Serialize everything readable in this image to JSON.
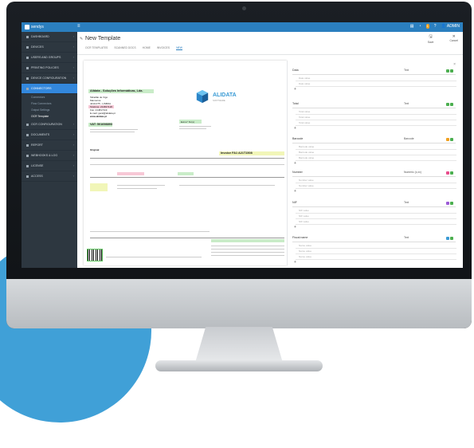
{
  "app": {
    "logo_text": "sendys",
    "title": "New Template",
    "breadcrumbs": [
      "OCR TEMPLATES",
      "SCANNED DOCS",
      "HOME",
      "INVOICES",
      "NEW"
    ],
    "head_buttons": [
      {
        "label": "Save",
        "icon": "save-icon"
      },
      {
        "label": "Cancel",
        "icon": "close-icon"
      }
    ],
    "user_label": "ADMIN",
    "notification_count": "1"
  },
  "sidebar": {
    "items": [
      {
        "label": "DASHBOARD",
        "icon": "dashboard-icon"
      },
      {
        "label": "DEVICES",
        "icon": "devices-icon"
      },
      {
        "label": "USERS AND GROUPS",
        "icon": "users-icon"
      },
      {
        "label": "PRINTING POLICIES",
        "icon": "printer-icon"
      },
      {
        "label": "DEVICE CONFIGURATION",
        "icon": "gear-icon"
      },
      {
        "label": "CONNECTORS",
        "icon": "plug-icon",
        "active": true
      }
    ],
    "subitems": [
      "Connectors",
      "Flow Connectors",
      "Output Settings",
      "OCR Template"
    ],
    "items_after": [
      {
        "label": "OCR CONFIGURATION",
        "icon": "ocr-icon"
      },
      {
        "label": "DOCUMENTS",
        "icon": "document-icon"
      },
      {
        "label": "REPORT",
        "icon": "report-icon"
      },
      {
        "label": "WEBHOOKS & LOG",
        "icon": "log-icon"
      },
      {
        "label": "LICENSE",
        "icon": "license-icon"
      },
      {
        "label": "ACCESS",
        "icon": "lock-icon"
      }
    ]
  },
  "document": {
    "company_name": "Alidata - Soluções Informáticas, Lda.",
    "address_lines": [
      "Tabelião de Vigo",
      "Mannorca",
      "4410-075 - LISBOA"
    ],
    "telephone": "Telefone: 214817120",
    "fax": "Fax: 214817119",
    "email": "E-mail: geral@alidata.pt",
    "web": "www.alidata.pt",
    "vat_label": "VAT: 501698893",
    "logo_text": "ALIDATA",
    "logo_sub": "SOFTWARE",
    "client_tag": "Exmo° Sr.(s)",
    "original_label": "Original",
    "invoice_number": "Invoice FA1 A21T1508"
  },
  "fields": [
    {
      "label": "Data",
      "type": "Text",
      "color": "#4caf50",
      "rows": [
        "Date value",
        "Date value"
      ]
    },
    {
      "label": "Total",
      "type": "Text",
      "color": "#4caf50",
      "rows": [
        "Total value",
        "Total value",
        "Total value"
      ]
    },
    {
      "label": "Barcode",
      "type": "Barcode",
      "color": "#f0a020",
      "rows": [
        "Barcode value",
        "Barcode value",
        "Barcode value"
      ]
    },
    {
      "label": "Number",
      "type": "Numeric (x,xx)",
      "color": "#e84c8b",
      "rows": [
        "Number value",
        "Number value"
      ]
    },
    {
      "label": "NIF",
      "type": "Text",
      "color": "#9c5bd6",
      "rows": [
        "NIF value",
        "NIF value",
        "NIF value"
      ]
    },
    {
      "label": "Fiscal name",
      "type": "Text",
      "color": "#3a9bd5",
      "rows": [
        "Name value",
        "Name value",
        "Name value"
      ]
    }
  ]
}
